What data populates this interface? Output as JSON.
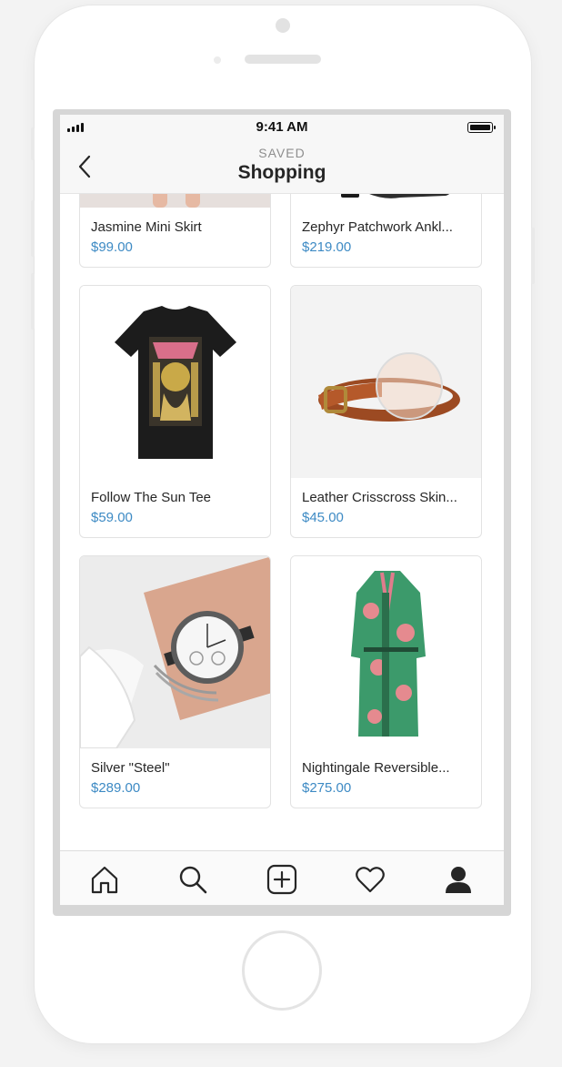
{
  "status_bar": {
    "time": "9:41 AM"
  },
  "header": {
    "subtitle": "SAVED",
    "title": "Shopping",
    "back_icon": "chevron-left-icon"
  },
  "products": [
    {
      "name": "Jasmine Mini Skirt",
      "price": "$99.00",
      "image": "skirt"
    },
    {
      "name": "Zephyr Patchwork Ankl...",
      "price": "$219.00",
      "image": "ankle-boot"
    },
    {
      "name": "Follow The Sun Tee",
      "price": "$59.00",
      "image": "black-graphic-tee"
    },
    {
      "name": "Leather Crisscross Skin...",
      "price": "$45.00",
      "image": "brown-leather-belt"
    },
    {
      "name": "Silver \"Steel\"",
      "price": "$289.00",
      "image": "wrist-watch"
    },
    {
      "name": "Nightingale Reversible...",
      "price": "$275.00",
      "image": "green-floral-robe"
    }
  ],
  "tab_bar": {
    "tabs": [
      "home-icon",
      "search-icon",
      "add-post-icon",
      "heart-icon",
      "profile-icon"
    ]
  },
  "colors": {
    "price": "#3d8ac4",
    "text": "#262626",
    "subtitle": "#8e8e8e"
  }
}
